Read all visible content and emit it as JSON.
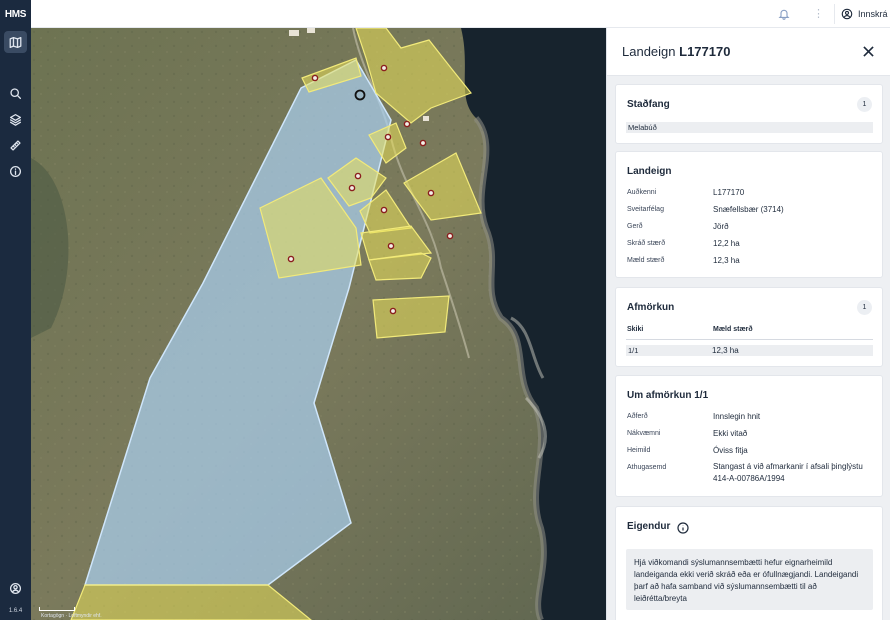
{
  "app": {
    "logo": "HMS",
    "version": "1.6.4"
  },
  "rail": {
    "items": [
      {
        "name": "map",
        "icon": "map-icon"
      },
      {
        "name": "search",
        "icon": "search-icon"
      },
      {
        "name": "layers",
        "icon": "layers-icon"
      },
      {
        "name": "measure",
        "icon": "ruler-icon"
      },
      {
        "name": "info",
        "icon": "info-icon"
      }
    ],
    "account_icon": "user-circle-icon"
  },
  "topbar": {
    "login_label": "Innskrá",
    "bell_icon": "bell-icon",
    "more_icon": "dots-vertical-icon"
  },
  "map": {
    "attribution": "Kortagögn · Loftmyndir ehf.",
    "colors": {
      "selected_fill": "#a9cfee",
      "parcel_fill": "#e9e05a",
      "parcel_stroke": "#f2ea7a"
    }
  },
  "panel": {
    "title_prefix": "Landeign",
    "title_id": "L177170",
    "close_icon": "close-icon",
    "stadfang": {
      "heading": "Staðfang",
      "count": "1",
      "value": "Melabúð"
    },
    "landeign": {
      "heading": "Landeign",
      "rows": [
        {
          "label": "Auðkenni",
          "value": "L177170"
        },
        {
          "label": "Sveitarfélag",
          "value": "Snæfellsbær (3714)"
        },
        {
          "label": "Gerð",
          "value": "Jörð"
        },
        {
          "label": "Skráð stærð",
          "value": "12,2 ha"
        },
        {
          "label": "Mæld stærð",
          "value": "12,3 ha"
        }
      ]
    },
    "afmorkun": {
      "heading": "Afmörkun",
      "count": "1",
      "col1": "Skiki",
      "col2": "Mæld stærð",
      "row": {
        "skiki": "1/1",
        "size": "12,3 ha"
      }
    },
    "um_afmorkun": {
      "heading": "Um afmörkun 1/1",
      "rows": [
        {
          "label": "Aðferð",
          "value": "Innslegin hnit"
        },
        {
          "label": "Nákvæmni",
          "value": "Ekki vitað"
        },
        {
          "label": "Heimild",
          "value": "Óviss fitja"
        },
        {
          "label": "Athugasemd",
          "value": "Stangast á við afmarkanir í afsali þinglýstu 414-A-00786A/1994"
        }
      ]
    },
    "eigendur": {
      "heading": "Eigendur",
      "notice": "Hjá viðkomandi sýslumannsembætti hefur eignarheimild landeiganda ekki verið skráð eða er ófullnægjandi. Landeigandi þarf að hafa samband við sýslumannsembætti til að leiðrétta/breyta"
    }
  }
}
